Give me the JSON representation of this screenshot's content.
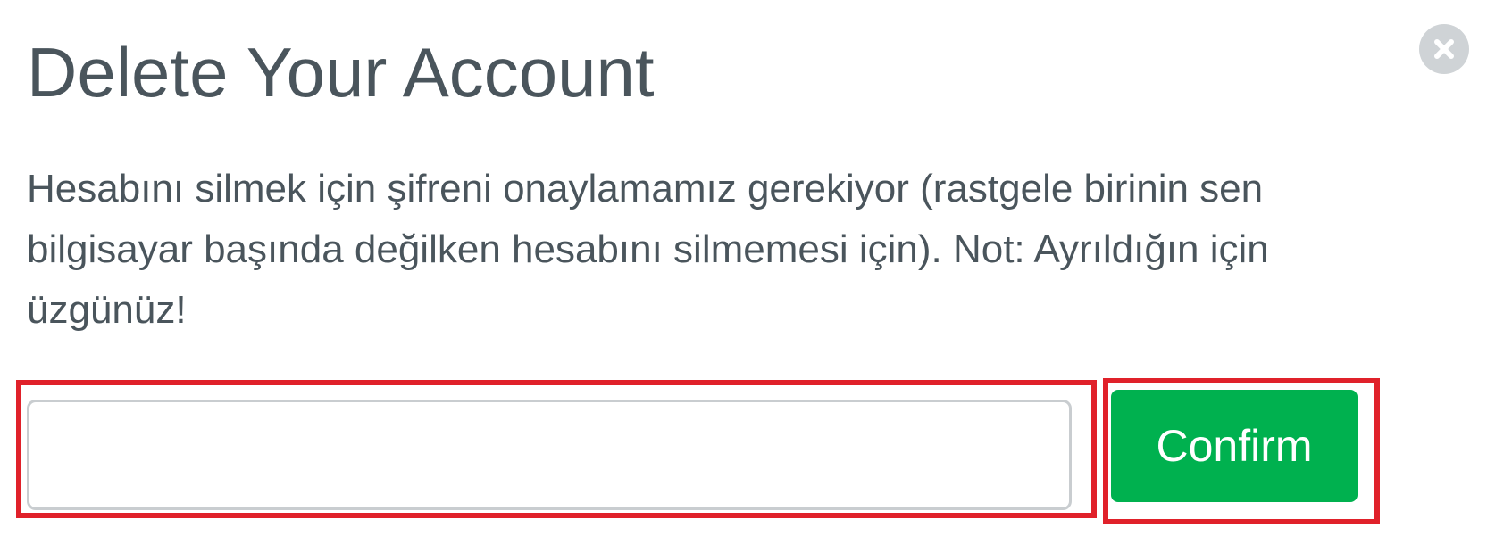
{
  "dialog": {
    "title": "Delete Your Account",
    "description": "Hesabını silmek için şifreni onaylamamız gerekiyor (rastgele birinin sen bilgisayar başında değilken hesabını silmemesi için). Not: Ayrıldığın için üzgünüz!",
    "password_input": {
      "value": "",
      "placeholder": ""
    },
    "confirm_label": "Confirm",
    "close_icon": "close-icon"
  },
  "colors": {
    "text": "#4a555c",
    "confirm_button": "#00b14f",
    "confirm_text": "#ffffff",
    "highlight_border": "#e0212a",
    "close_icon_bg": "#cfd3d6",
    "input_border": "#c9cdd0"
  }
}
